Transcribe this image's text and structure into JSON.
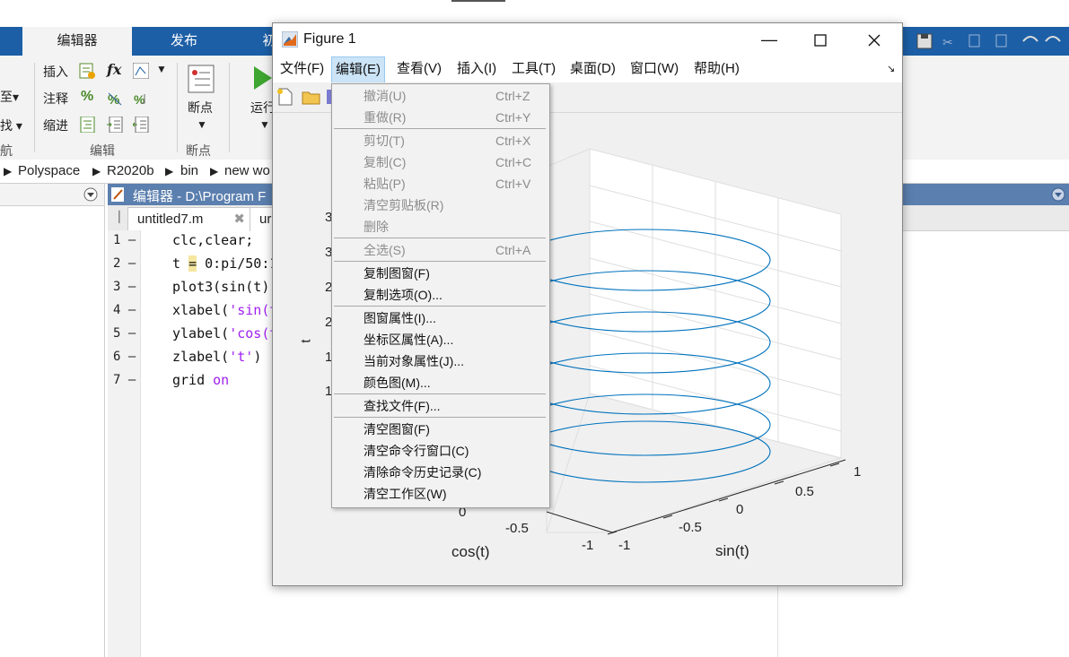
{
  "ribbon": {
    "tabs": [
      "编辑器",
      "发布",
      "初"
    ],
    "row_insert": "插入",
    "row_comment": "注释",
    "row_indent": "缩进",
    "fx_label": "fx",
    "percent_label": "%",
    "group_edit": "编辑",
    "group_breakpoints": "断点",
    "breakpoints_button": "断点",
    "run_button": "运行",
    "left_cut_1": "至▾",
    "left_cut_2": "找 ▾",
    "left_cut_3": "航"
  },
  "address": {
    "crumbs": [
      "Polyspace",
      "R2020b",
      "bin",
      "new wo"
    ]
  },
  "editor": {
    "header_title": "编辑器 - D:\\Program F",
    "tab1": "untitled7.m",
    "tab2": "ur",
    "line_numbers": [
      "1 —",
      "2 —",
      "3 —",
      "4 —",
      "5 —",
      "6 —",
      "7 —"
    ],
    "code": {
      "l1": "clc,clear;",
      "l2_a": "t ",
      "l2_b": "=",
      "l2_c": " 0:pi/50:1",
      "l3": "plot3(sin(t),",
      "l4_a": "xlabel(",
      "l4_b": "'sin(t",
      "l5_a": "ylabel(",
      "l5_b": "'cos(t",
      "l6_a": "zlabel(",
      "l6_b": "'t'",
      "l6_c": ")",
      "l7_a": "grid ",
      "l7_b": "on"
    }
  },
  "figure": {
    "title": "Figure 1",
    "menu": [
      "文件(F)",
      "编辑(E)",
      "查看(V)",
      "插入(I)",
      "工具(T)",
      "桌面(D)",
      "窗口(W)",
      "帮助(H)"
    ],
    "active_menu_index": 1
  },
  "edit_menu": {
    "undo": {
      "label": "撤消(U)",
      "shortcut": "Ctrl+Z"
    },
    "redo": {
      "label": "重做(R)",
      "shortcut": "Ctrl+Y"
    },
    "cut": {
      "label": "剪切(T)",
      "shortcut": "Ctrl+X"
    },
    "copy": {
      "label": "复制(C)",
      "shortcut": "Ctrl+C"
    },
    "paste": {
      "label": "粘贴(P)",
      "shortcut": "Ctrl+V"
    },
    "clear_clipboard": {
      "label": "清空剪贴板(R)"
    },
    "delete": {
      "label": "删除"
    },
    "select_all": {
      "label": "全选(S)",
      "shortcut": "Ctrl+A"
    },
    "copy_figure": {
      "label": "复制图窗(F)"
    },
    "copy_options": {
      "label": "复制选项(O)..."
    },
    "figure_properties": {
      "label": "图窗属性(I)..."
    },
    "axes_properties": {
      "label": "坐标区属性(A)..."
    },
    "current_object_properties": {
      "label": "当前对象属性(J)..."
    },
    "colormap": {
      "label": "颜色图(M)..."
    },
    "find_files": {
      "label": "查找文件(F)..."
    },
    "clear_figure": {
      "label": "清空图窗(F)"
    },
    "clear_command_window": {
      "label": "清空命令行窗口(C)"
    },
    "clear_command_history": {
      "label": "清除命令历史记录(C)"
    },
    "clear_workspace": {
      "label": "清空工作区(W)"
    }
  },
  "plot": {
    "xlabel": "sin(t)",
    "ylabel": "cos(t)",
    "zlabel": "t",
    "sin_ticks": [
      "-1",
      "-0.5",
      "0",
      "0.5",
      "1"
    ],
    "cos_ticks": [
      "-1",
      "-0.5",
      "0"
    ],
    "z_tick_partials": [
      "3",
      "3",
      "2",
      "2",
      "1",
      "1"
    ],
    "line_color": "#0072bd"
  }
}
